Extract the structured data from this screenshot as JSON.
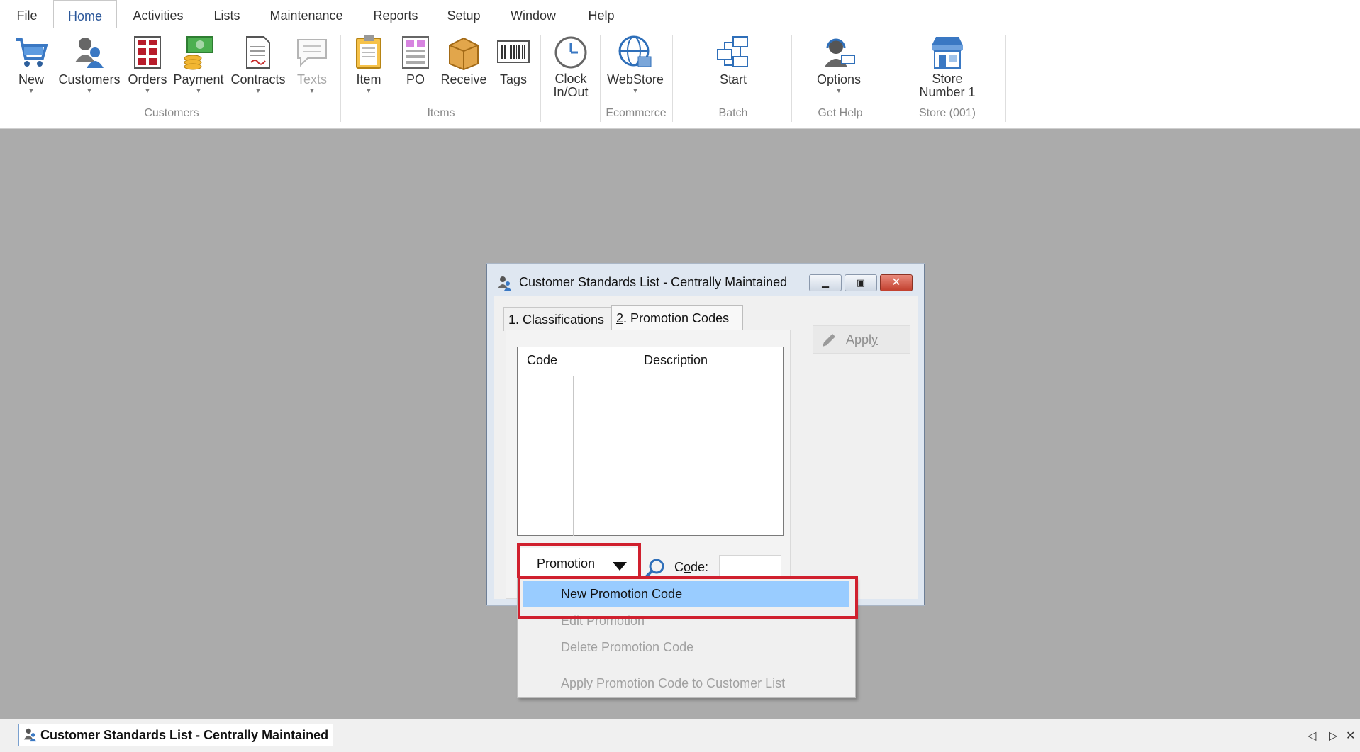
{
  "menu": {
    "items": [
      "File",
      "Home",
      "Activities",
      "Lists",
      "Maintenance",
      "Reports",
      "Setup",
      "Window",
      "Help"
    ],
    "active": "Home"
  },
  "ribbon": {
    "customers_group": {
      "label": "Customers",
      "buttons": [
        {
          "label": "New",
          "icon": "shopping-cart-icon"
        },
        {
          "label": "Customers",
          "icon": "customer-person-icon"
        },
        {
          "label": "Orders",
          "icon": "orders-grid-icon"
        },
        {
          "label": "Payment",
          "icon": "payment-money-icon"
        },
        {
          "label": "Contracts",
          "icon": "contract-document-icon"
        },
        {
          "label": "Texts",
          "icon": "speech-bubble-icon"
        }
      ]
    },
    "items_group": {
      "label": "Items",
      "buttons": [
        {
          "label": "Item",
          "icon": "clipboard-icon"
        },
        {
          "label": "PO",
          "icon": "purchase-order-icon"
        },
        {
          "label": "Receive",
          "icon": "box-icon"
        },
        {
          "label": "Tags",
          "icon": "barcode-icon"
        }
      ]
    },
    "clock": {
      "line1": "Clock",
      "line2": "In/Out",
      "icon": "clock-icon"
    },
    "ecommerce_group": {
      "label": "Ecommerce",
      "button": "WebStore",
      "icon": "globe-store-icon"
    },
    "batch_group": {
      "label": "Batch",
      "button": "Start",
      "icon": "network-icon"
    },
    "gethelp_group": {
      "label": "Get Help",
      "button": "Options",
      "icon": "support-headset-icon"
    },
    "store_group": {
      "label": "Store (001)",
      "line1": "Store",
      "line2": "Number 1",
      "icon": "storefront-icon"
    }
  },
  "dialog": {
    "title": "Customer Standards List - Centrally Maintained",
    "tabs": [
      {
        "num": "1",
        "label": ". Classifications"
      },
      {
        "num": "2",
        "label": ". Promotion Codes"
      }
    ],
    "grid": {
      "col_code": "Code",
      "col_description": "Description"
    },
    "apply_pre": "Appl",
    "apply_u": "y",
    "promotion_button": "Promotion",
    "code_label_pre": "C",
    "code_label_u": "o",
    "code_label_post": "de:"
  },
  "dropdown": {
    "items": [
      "New Promotion Code",
      "Edit Promotion",
      "Delete Promotion Code",
      "Apply Promotion Code to Customer List"
    ]
  },
  "taskbar": {
    "item": "Customer Standards List - Centrally Maintained"
  },
  "colors": {
    "accent": "#2b579a",
    "highlight": "#99ccff",
    "annotation_red": "#d0202e",
    "workspace": "#ababab"
  }
}
